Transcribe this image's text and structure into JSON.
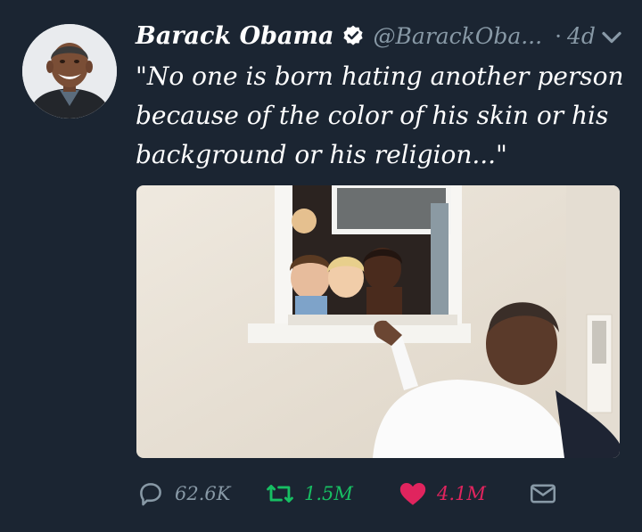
{
  "tweet": {
    "author_name": "Barack Obama",
    "handle": "@BarackOba...",
    "separator": "·",
    "time": "4d",
    "text_lines": [
      "\"No one is born hating another person",
      "because of the color of his skin or his",
      "background or his religion...\""
    ]
  },
  "actions": {
    "replies": "62.6K",
    "retweets": "1.5M",
    "likes": "4.1M"
  },
  "icons": {
    "verified": "verified-badge-icon",
    "menu": "chevron-down-icon",
    "reply": "reply-icon",
    "retweet": "retweet-icon",
    "like": "heart-icon",
    "dm": "direct-message-icon"
  },
  "colors": {
    "background": "#1b2532",
    "secondary_text": "#8899a6",
    "retweet": "#17bf63",
    "like": "#e0245e"
  }
}
